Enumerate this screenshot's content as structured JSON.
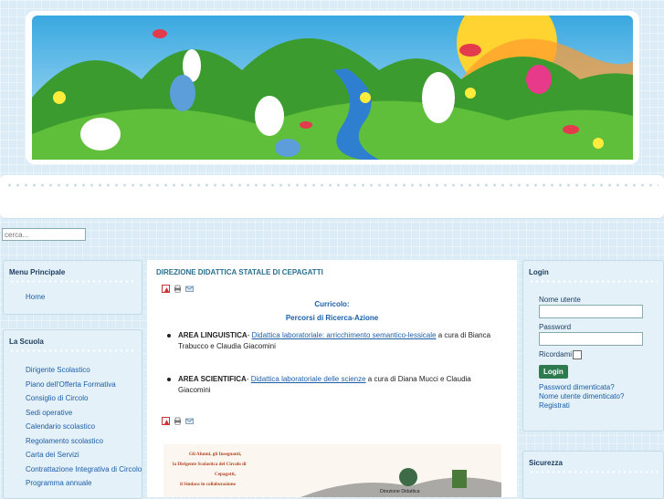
{
  "search": {
    "placeholder": "cerca..."
  },
  "menu_principale": {
    "title": "Menu Principale",
    "items": [
      {
        "label": "Home"
      }
    ]
  },
  "la_scuola": {
    "title": "La Scuola",
    "items": [
      {
        "label": "Dirigente Scolastico"
      },
      {
        "label": "Piano dell'Offerta Formativa"
      },
      {
        "label": "Consiglio di Circolo"
      },
      {
        "label": "Sedi operative"
      },
      {
        "label": "Calendario scolastico"
      },
      {
        "label": "Regolamento scolastico"
      },
      {
        "label": "Carta dei Servizi"
      },
      {
        "label": "Contrattazione Integrativa di Circolo"
      },
      {
        "label": "Programma annuale"
      }
    ]
  },
  "article": {
    "title": "DIREZIONE DIDATTICA STATALE DI CEPAGATTI",
    "icons": [
      "pdf-icon",
      "print-icon",
      "email-icon"
    ],
    "heading1": "Curricolo:",
    "heading2": "Percorsi di Ricerca-Azione",
    "area1": {
      "label": "AREA LINGUISTICA",
      "sep": "- ",
      "link": "Didattica laboratoriale: arricchimento semantico-lessicale",
      "rest": " a cura di Bianca Trabucco e Claudia Giacomini"
    },
    "area2": {
      "label": "AREA SCIENTIFICA",
      "sep": "- ",
      "link": "Didattica laboratoriale delle scienze",
      "rest": " a cura di Diana Mucci e Claudia Giacomini"
    },
    "image_lines": [
      "Gli Alunni, gli Insegnanti,",
      "la Dirigente Scolastica del Circolo di",
      "Cepagatti,",
      "il Sindaco in collaborazione",
      "Direzione Didattica"
    ]
  },
  "login": {
    "title": "Login",
    "username_label": "Nome utente",
    "password_label": "Password",
    "remember_label": "Ricordami",
    "button": "Login",
    "forgot_password": "Password dimenticata?",
    "forgot_username": "Nome utente dimenticato?",
    "register": "Registrati"
  },
  "sicurezza": {
    "title": "Sicurezza"
  },
  "colors": {
    "accent": "#1b5ea8",
    "title": "#2a6f8f",
    "button": "#2d7a4f",
    "panel": "#e4f1f9"
  }
}
